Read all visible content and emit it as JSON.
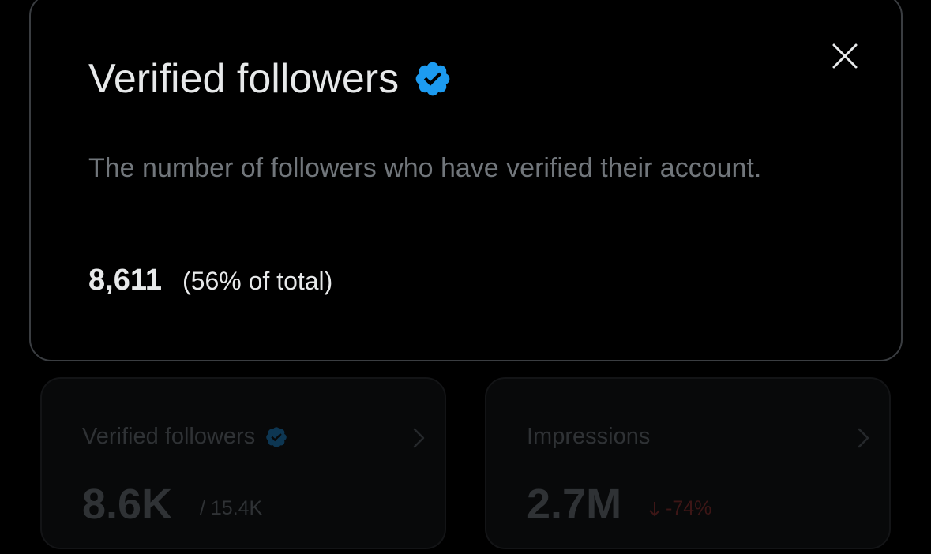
{
  "modal": {
    "title": "Verified followers",
    "description": "The number of followers who have verified their account.",
    "count": "8,611",
    "percent_text": "(56% of total)",
    "close_icon": "close-icon",
    "badge_icon": "verified-badge-icon"
  },
  "cards": {
    "verified": {
      "label": "Verified followers",
      "value": "8.6K",
      "total": "/ 15.4K"
    },
    "impressions": {
      "label": "Impressions",
      "value": "2.7M",
      "change": "-74%",
      "change_icon": "arrow-down-icon"
    }
  },
  "colors": {
    "background": "#000000",
    "primary_text": "#e7e9ea",
    "secondary_text": "#71767b",
    "verified_blue": "#1d9bf0",
    "negative": "#f4212e"
  }
}
